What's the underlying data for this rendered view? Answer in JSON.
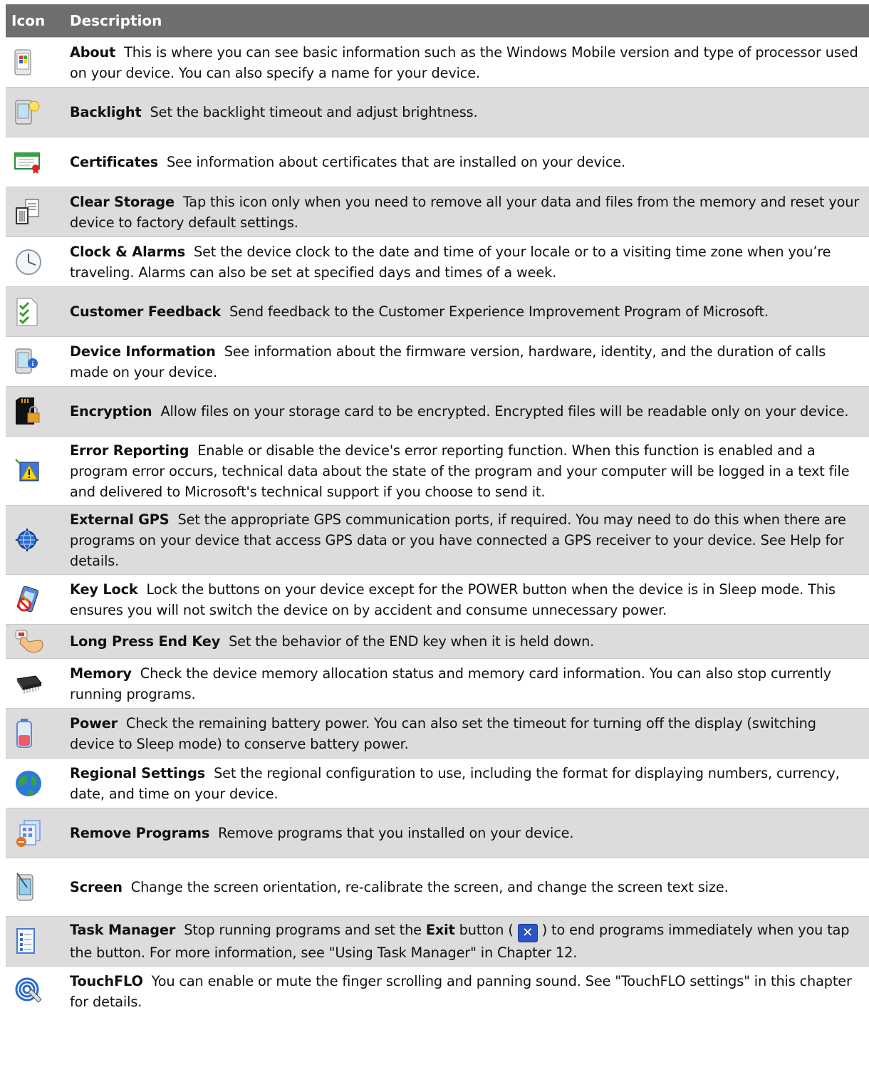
{
  "header": {
    "icon_col": "Icon",
    "desc_col": "Description"
  },
  "rows": [
    {
      "icon": "about-icon",
      "title": "About",
      "text": "This is where you can see basic information such as the Windows Mobile version and type of processor used on your device. You can also specify a name for your device."
    },
    {
      "icon": "backlight-icon",
      "title": "Backlight",
      "text": "Set the backlight timeout and adjust brightness."
    },
    {
      "icon": "certificates-icon",
      "title": "Certificates",
      "text": "See information about certificates that are installed on your device."
    },
    {
      "icon": "clear-storage-icon",
      "title": "Clear Storage",
      "text": "Tap this icon only when you need to remove all your data and files from the memory and reset your device to factory default settings."
    },
    {
      "icon": "clock-icon",
      "title": "Clock & Alarms",
      "text": "Set the device clock to the date and time of your locale or to a visiting time zone when you’re traveling. Alarms can also be set at specified days and times of a week."
    },
    {
      "icon": "customer-feedback-icon",
      "title": "Customer Feedback",
      "text": "Send feedback to the Customer Experience Improvement Program of Microsoft."
    },
    {
      "icon": "device-information-icon",
      "title": "Device Information",
      "text": "See information about the firmware version, hardware, identity, and the duration of calls made on your device."
    },
    {
      "icon": "encryption-icon",
      "title": "Encryption",
      "text": "Allow files on your storage card to be encrypted. Encrypted files will be readable only on your device."
    },
    {
      "icon": "error-reporting-icon",
      "title": "Error Reporting",
      "text": "Enable or disable the device's error reporting function. When this function is enabled and a program error occurs, technical data about the state of the program and your computer will be logged in a text file and delivered to Microsoft's technical support if you choose to send it."
    },
    {
      "icon": "external-gps-icon",
      "title": "External GPS",
      "text": "Set the appropriate GPS communication ports, if required. You may need to do this when there are programs on your device that access GPS data or you have connected a GPS receiver to your device. See Help for details."
    },
    {
      "icon": "key-lock-icon",
      "title": "Key Lock",
      "text": "Lock the buttons on your device except for the POWER button when the device is in Sleep mode. This ensures you will not switch the device on by accident and consume unnecessary power."
    },
    {
      "icon": "long-press-end-key-icon",
      "title": "Long Press End Key",
      "text": "Set the behavior of the END key when it is held down."
    },
    {
      "icon": "memory-icon",
      "title": "Memory",
      "text": "Check the device memory allocation status and memory card information. You can also stop currently running programs."
    },
    {
      "icon": "power-icon",
      "title": "Power",
      "text": "Check the remaining battery power. You can also set the timeout for turning off the display (switching device to Sleep mode) to conserve battery power."
    },
    {
      "icon": "regional-settings-icon",
      "title": "Regional Settings",
      "text": "Set the regional configuration to use, including the format for displaying numbers, currency, date, and time on your device."
    },
    {
      "icon": "remove-programs-icon",
      "title": "Remove Programs",
      "text": "Remove programs that you installed on your device."
    },
    {
      "icon": "screen-icon",
      "title": "Screen",
      "text": "Change the screen orientation, re-calibrate the screen, and change the screen text size."
    },
    {
      "icon": "task-manager-icon",
      "title": "Task Manager",
      "text_a": "Stop running programs and set the",
      "text_b": "Exit",
      "text_c": "button (",
      "text_d": ") to end programs immediately when you tap the button. For more information, see \"Using Task Manager\" in Chapter 12."
    },
    {
      "icon": "touchflo-icon",
      "title": "TouchFLO",
      "text": "You can enable or mute the finger scrolling and panning sound. See \"TouchFLO settings\" in this chapter for details."
    }
  ],
  "exit_button_glyph": "✕"
}
